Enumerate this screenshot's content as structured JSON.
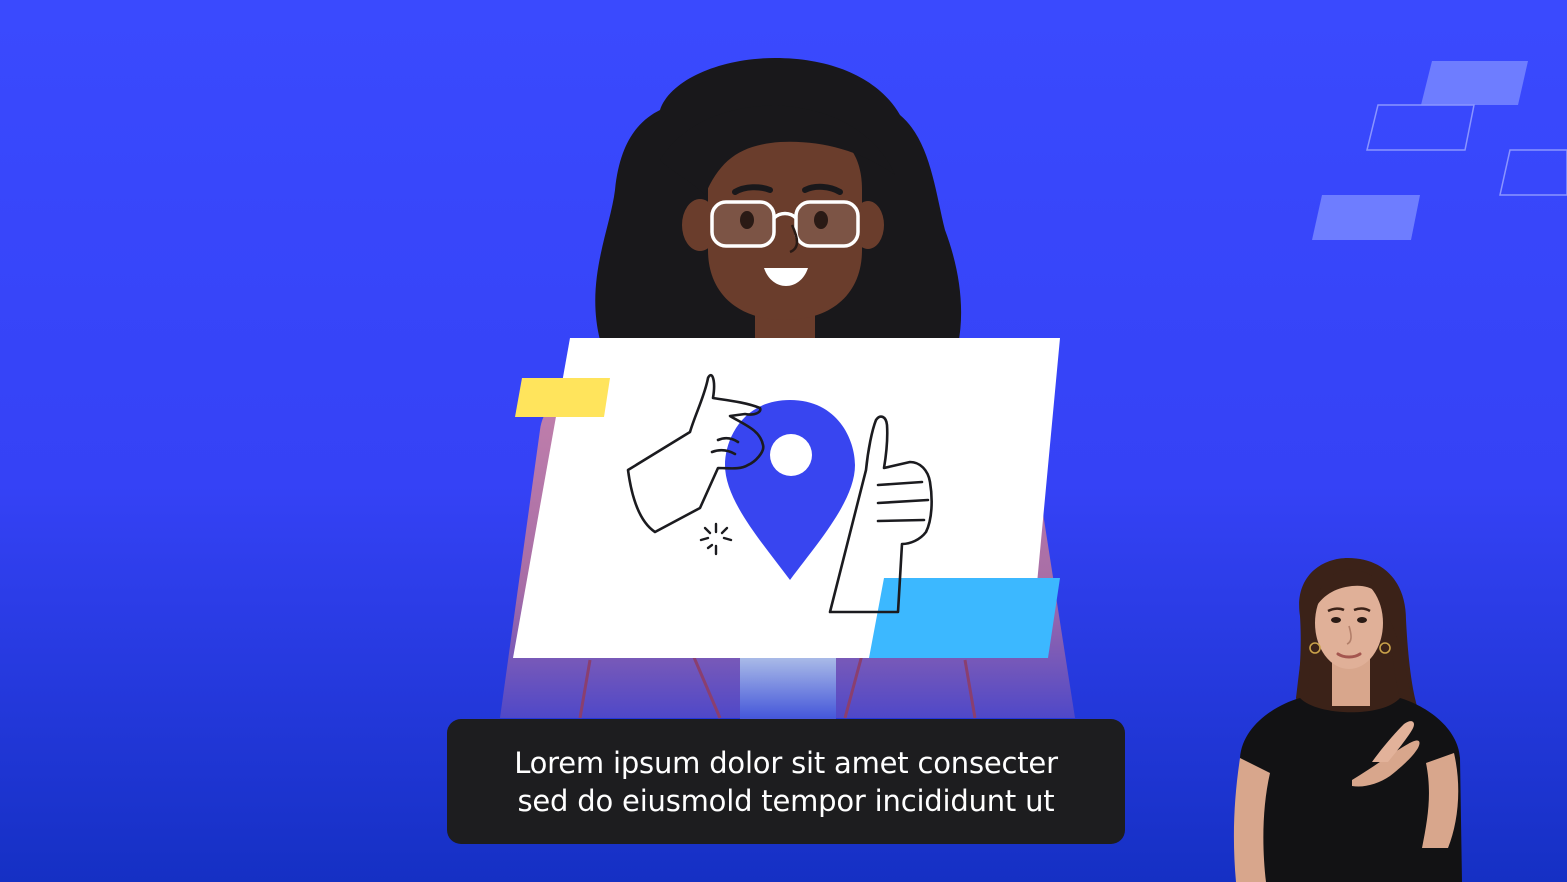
{
  "captions": {
    "line1": "Lorem ipsum dolor sit amet consecter",
    "line2": "sed do eiusmold tempor incididunt ut"
  },
  "colors": {
    "background_top": "#3a4afe",
    "background_bottom": "#1530c4",
    "accent_blue": "#3845f0",
    "accent_yellow": "#ffe45c",
    "accent_cyan": "#3cb8ff",
    "caption_bg": "#1d1d1f"
  },
  "icons": [
    "location-pin-icon",
    "pinch-hand-icon",
    "thumbs-up-hand-icon",
    "sparkle-icon"
  ]
}
